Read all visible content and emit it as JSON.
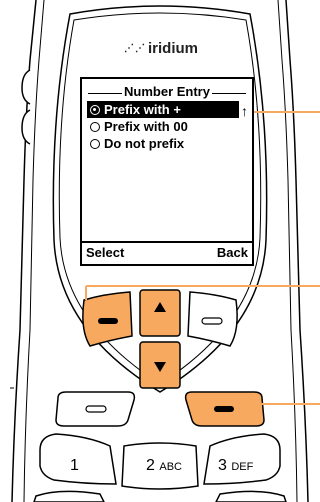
{
  "device": {
    "brand": "iridium",
    "colors": {
      "accent": "#f7a95f",
      "screen": "#ffffff",
      "outline": "#000000"
    }
  },
  "screen": {
    "title": "Number Entry",
    "options": [
      {
        "label": "Prefix with +",
        "selected": true
      },
      {
        "label": "Prefix with 00",
        "selected": false
      },
      {
        "label": "Do not prefix",
        "selected": false
      }
    ],
    "scroll_indicator": "↑",
    "left_softkey": "Select",
    "right_softkey": "Back"
  },
  "keypad": {
    "key_1": {
      "digit": "1",
      "letters": ""
    },
    "key_2": {
      "digit": "2",
      "letters": "ABC"
    },
    "key_3": {
      "digit": "3",
      "letters": "DEF"
    }
  }
}
